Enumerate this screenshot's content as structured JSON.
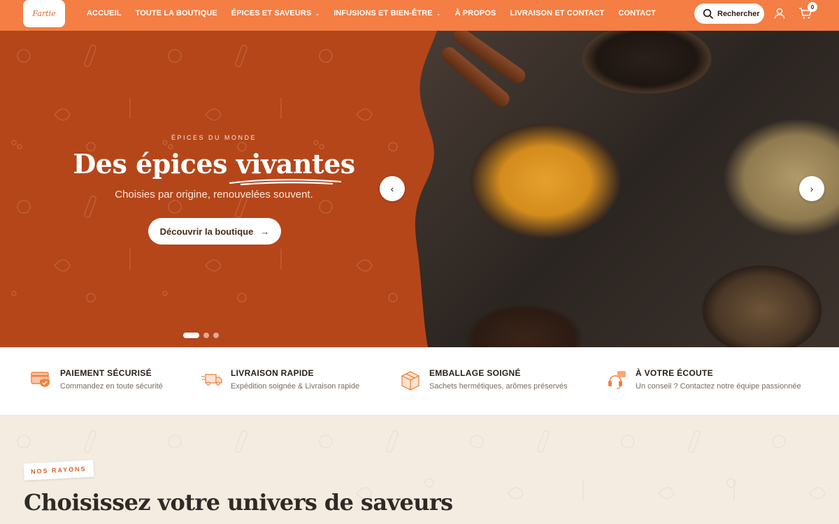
{
  "header": {
    "logo_text": "Fartie",
    "nav": [
      {
        "label": "ACCUEIL",
        "dropdown": false
      },
      {
        "label": "TOUTE LA BOUTIQUE",
        "dropdown": false
      },
      {
        "label": "ÉPICES ET SAVEURS",
        "dropdown": true
      },
      {
        "label": "INFUSIONS ET BIEN-ÊTRE",
        "dropdown": true
      },
      {
        "label": "À PROPOS",
        "dropdown": false
      },
      {
        "label": "LIVRAISON ET CONTACT",
        "dropdown": false
      },
      {
        "label": "CONTACT",
        "dropdown": false
      }
    ],
    "search_label": "Rechercher",
    "cart_count": "0",
    "icons": {
      "search": "search-icon",
      "account": "user-icon",
      "cart": "cart-icon"
    }
  },
  "hero": {
    "eyebrow": "ÉPICES DU MONDE",
    "title_plain": "Des épices",
    "title_accent": "vivantes",
    "subtitle": "Choisies par origine, renouvelées souvent.",
    "cta_label": "Découvrir la boutique",
    "cta_arrow": "→",
    "prev_arrow": "‹",
    "next_arrow": "›",
    "slides": {
      "count": 3,
      "active": 1
    }
  },
  "features": [
    {
      "icon": "credit-card-shield-icon",
      "title": "PAIEMENT SÉCURISÉ",
      "desc": "Commandez en toute sécurité"
    },
    {
      "icon": "delivery-truck-icon",
      "title": "LIVRAISON RAPIDE",
      "desc": "Expédition soignée & Livraison rapide"
    },
    {
      "icon": "package-box-icon",
      "title": "EMBALLAGE SOIGNÉ",
      "desc": "Sachets hermétiques, arômes préservés"
    },
    {
      "icon": "headset-support-icon",
      "title": "À VOTRE ÉCOUTE",
      "desc": "Un conseil ? Contactez notre équipe passionnée"
    }
  ],
  "rayons": {
    "badge": "NOS RAYONS",
    "title": "Choisissez votre univers de saveurs"
  },
  "colors": {
    "brand_orange": "#f47e43",
    "hero_rust": "#b5461a",
    "accent_orange": "#f0823f",
    "cream": "#f4ece0"
  }
}
